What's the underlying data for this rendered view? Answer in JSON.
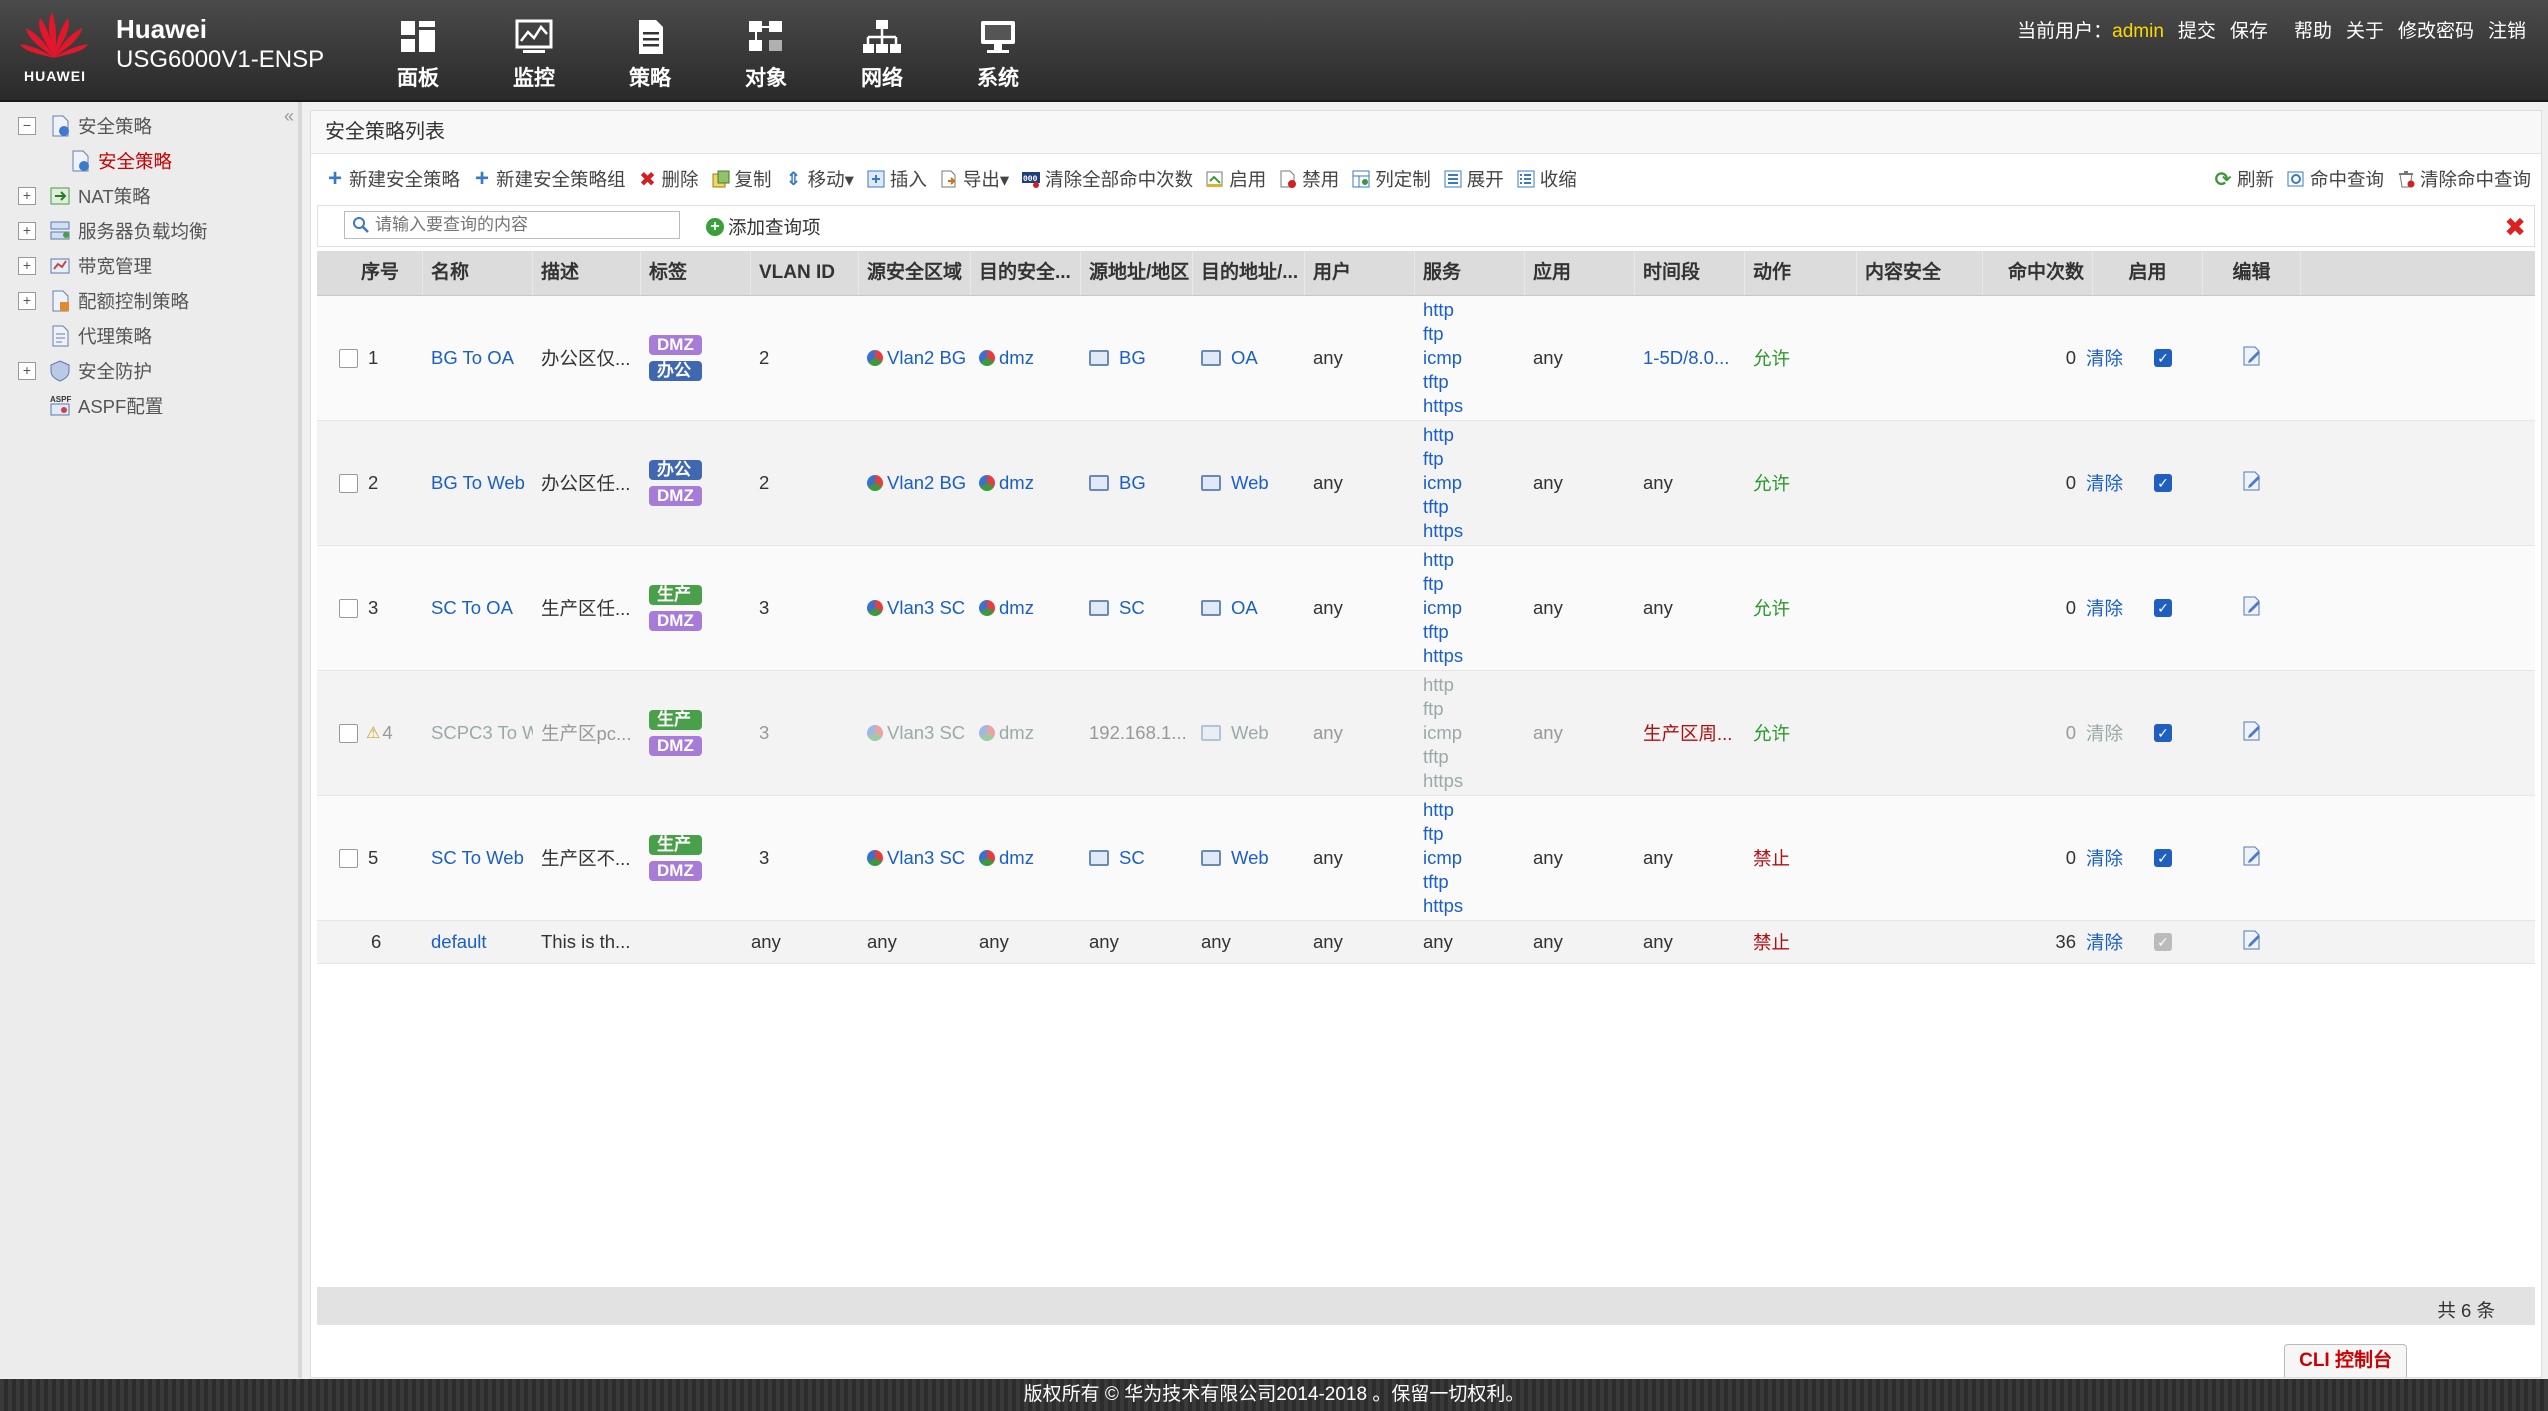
{
  "brand": {
    "logo_text": "HUAWEI",
    "vendor": "Huawei",
    "model": "USG6000V1-ENSP"
  },
  "nav": [
    {
      "label": "面板",
      "icon": "dashboard-icon"
    },
    {
      "label": "监控",
      "icon": "monitor-icon"
    },
    {
      "label": "策略",
      "icon": "policy-icon"
    },
    {
      "label": "对象",
      "icon": "object-icon"
    },
    {
      "label": "网络",
      "icon": "network-icon"
    },
    {
      "label": "系统",
      "icon": "system-icon"
    }
  ],
  "topbar": {
    "user_label": "当前用户：",
    "user": "admin",
    "links": [
      "提交",
      "保存",
      "帮助",
      "关于",
      "修改密码",
      "注销"
    ]
  },
  "sidebar": {
    "collapse": "«",
    "items": [
      {
        "label": "安全策略",
        "toggle": "−"
      },
      {
        "label": "安全策略"
      },
      {
        "label": "NAT策略",
        "toggle": "+"
      },
      {
        "label": "服务器负载均衡",
        "toggle": "+"
      },
      {
        "label": "带宽管理",
        "toggle": "+"
      },
      {
        "label": "配额控制策略",
        "toggle": "+"
      },
      {
        "label": "代理策略"
      },
      {
        "label": "安全防护",
        "toggle": "+"
      },
      {
        "label": "ASPF配置"
      }
    ]
  },
  "panel": {
    "title": "安全策略列表"
  },
  "toolbar": {
    "left": [
      "新建安全策略",
      "新建安全策略组",
      "删除",
      "复制",
      "移动▾",
      "插入",
      "导出▾",
      "清除全部命中次数",
      "启用",
      "禁用",
      "列定制",
      "展开",
      "收缩"
    ],
    "right": [
      "刷新",
      "命中查询",
      "清除命中查询"
    ]
  },
  "filter": {
    "placeholder": "请输入要查询的内容",
    "add_query": "添加查询项",
    "clear": "✖"
  },
  "table": {
    "headers": [
      "序号",
      "名称",
      "描述",
      "标签",
      "VLAN ID",
      "源安全区域",
      "目的安全...",
      "源地址/地区",
      "目的地址/...",
      "用户",
      "服务",
      "应用",
      "时间段",
      "动作",
      "内容安全",
      "命中次数",
      "启用",
      "编辑"
    ],
    "rows": [
      {
        "no": "1",
        "name": "BG To OA",
        "desc": "办公区仅...",
        "tags": [
          "DMZ",
          "办公"
        ],
        "vlan": "2",
        "src_zone": "Vlan2 BG",
        "dst_zone": "dmz",
        "src_addr": "BG",
        "dst_addr": "OA",
        "user": "any",
        "services": [
          "http",
          "ftp",
          "icmp",
          "tftp",
          "https"
        ],
        "app": "any",
        "time": "1-5D/8.0...",
        "action": "允许",
        "content": "",
        "hits": "0",
        "clear": "清除",
        "enabled": true
      },
      {
        "no": "2",
        "name": "BG To Web",
        "desc": "办公区任...",
        "tags": [
          "办公",
          "DMZ"
        ],
        "vlan": "2",
        "src_zone": "Vlan2 BG",
        "dst_zone": "dmz",
        "src_addr": "BG",
        "dst_addr": "Web",
        "user": "any",
        "services": [
          "http",
          "ftp",
          "icmp",
          "tftp",
          "https"
        ],
        "app": "any",
        "time": "any",
        "action": "允许",
        "content": "",
        "hits": "0",
        "clear": "清除",
        "enabled": true
      },
      {
        "no": "3",
        "name": "SC To OA",
        "desc": "生产区任...",
        "tags": [
          "生产",
          "DMZ"
        ],
        "vlan": "3",
        "src_zone": "Vlan3 SC",
        "dst_zone": "dmz",
        "src_addr": "SC",
        "dst_addr": "OA",
        "user": "any",
        "services": [
          "http",
          "ftp",
          "icmp",
          "tftp",
          "https"
        ],
        "app": "any",
        "time": "any",
        "action": "允许",
        "content": "",
        "hits": "0",
        "clear": "清除",
        "enabled": true
      },
      {
        "no": "4",
        "name": "SCPC3 To Web",
        "desc": "生产区pc...",
        "tags": [
          "生产",
          "DMZ"
        ],
        "vlan": "3",
        "src_zone": "Vlan3 SC",
        "dst_zone": "dmz",
        "src_addr": "192.168.1...",
        "dst_addr": "Web",
        "user": "any",
        "services": [
          "http",
          "ftp",
          "icmp",
          "tftp",
          "https"
        ],
        "app": "any",
        "time": "生产区周...",
        "action": "允许",
        "content": "",
        "hits": "0",
        "clear": "清除",
        "enabled": true,
        "inactive": true
      },
      {
        "no": "5",
        "name": "SC To Web",
        "desc": "生产区不...",
        "tags": [
          "生产",
          "DMZ"
        ],
        "vlan": "3",
        "src_zone": "Vlan3 SC",
        "dst_zone": "dmz",
        "src_addr": "SC",
        "dst_addr": "Web",
        "user": "any",
        "services": [
          "http",
          "ftp",
          "icmp",
          "tftp",
          "https"
        ],
        "app": "any",
        "time": "any",
        "action": "禁止",
        "content": "",
        "hits": "0",
        "clear": "清除",
        "enabled": true
      },
      {
        "no": "6",
        "name": "default",
        "desc": "This is th...",
        "tags": [],
        "vlan": "any",
        "src_zone": "any",
        "dst_zone": "any",
        "src_addr": "any",
        "dst_addr": "any",
        "user": "any",
        "services": [
          "any"
        ],
        "app": "any",
        "time": "any",
        "action": "禁止",
        "content": "",
        "hits": "36",
        "clear": "清除",
        "enabled": true,
        "default": true
      }
    ]
  },
  "tag_colors": {
    "DMZ": "#a77bd8",
    "办公": "#3f68b0",
    "生产": "#4aa04a"
  },
  "status": {
    "total": "共 6 条"
  },
  "cli_button": "CLI 控制台",
  "footer": "版权所有 © 华为技术有限公司2014-2018 。保留一切权利。"
}
